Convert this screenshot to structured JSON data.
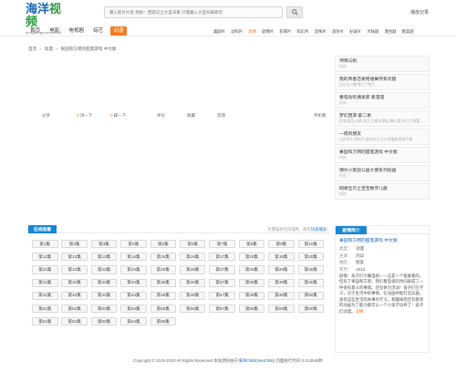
{
  "logo": {
    "main_a": "海洋",
    "main_b": "视频",
    "sub": "dongfangmovie.com"
  },
  "search": {
    "placeholder": "输入影片片名 例如：西游记之大圣归来 只需输入大圣归来即可"
  },
  "history": "播放记录",
  "nav": {
    "main": [
      "首页",
      "电影",
      "电视剧",
      "综艺",
      "动漫"
    ],
    "active": 4,
    "sub": [
      "喜剧片",
      "动作片",
      "爱情",
      "剧情片",
      "犯罪片",
      "科幻片",
      "恐怖片",
      "战争片",
      "纪录片",
      "大陆剧",
      "港台剧",
      "欧美剧"
    ],
    "sub_active": 2
  },
  "breadcrumb": [
    "首页",
    "动漫",
    "果园和方明的甜蜜游戏 中文版"
  ],
  "toolbar": {
    "share": "分享",
    "up_count": "0",
    "up": "顶一下",
    "down_count": "0",
    "down": "踩一下",
    "comment": "评论",
    "favorite": "收藏",
    "report": "反馈",
    "phone": "手机看"
  },
  "sidebar": [
    {
      "title": "师傅与帆",
      "sub": "内详"
    },
    {
      "title": "我的青春恋爱物语果然有问题",
      "sub": "比企谷八幡,雪之下雪乃"
    },
    {
      "title": "番电动玩偶发家 看漫漫",
      "sub": "内详"
    },
    {
      "title": "梦幻西游 第二季",
      "sub": "俞涛,梁吾,白桦,张卫,王硕金,黄松,魏小爱,刘力刀,陈蕾"
    },
    {
      "title": "一周的朋友",
      "sub": "山谷祥生,雨宫天,细谷佳正,大久保瑠美,野波千鹤"
    },
    {
      "title": "果园和方明的甜蜜游戏 中文版",
      "sub": "内详"
    },
    {
      "title": "瑞尔小旅鼠公益大使系列动画",
      "sub": "内详"
    },
    {
      "title": "网课全贝之宝宝数学儿歌",
      "sub": "内详"
    }
  ],
  "playlist": {
    "tab": "在线观看",
    "note_a": "无需安装任何插件，即可",
    "note_b": "快速播放",
    "episodes": [
      "第1集",
      "第2集",
      "第3集",
      "第4集",
      "第5集",
      "第6集",
      "第7集",
      "第8集",
      "第9集",
      "第10集",
      "第11集",
      "第12集",
      "第13集",
      "第14集",
      "第15集",
      "第16集",
      "第17集",
      "第18集",
      "第19集",
      "第20集",
      "第21集",
      "第22集",
      "第23集",
      "第24集",
      "第25集",
      "第26集",
      "第27集",
      "第28集",
      "第29集",
      "第30集",
      "第31集",
      "第32集",
      "第33集",
      "第34集",
      "第35集",
      "第36集",
      "第37集",
      "第38集",
      "第39集",
      "第40集",
      "第41集",
      "第42集",
      "第43集",
      "第44集",
      "第45集",
      "第46集",
      "第47集",
      "第48集",
      "第49集",
      "第50集",
      "第51集",
      "第52集",
      "第53集",
      "第54集",
      "第55集",
      "第56集",
      "第57集",
      "第58集",
      "第59集",
      "第60集",
      "第61集",
      "第62集",
      "第63集",
      "第64集",
      "第65集"
    ]
  },
  "info": {
    "tab": "剧情简介",
    "title": "果园和方明的甜蜜游戏 中文版",
    "rows": [
      {
        "k": "类型：",
        "v": "动漫"
      },
      {
        "k": "主演：",
        "v": "内详"
      },
      {
        "k": "地区：",
        "v": "欧美"
      },
      {
        "k": "年代：",
        "v": "2013"
      }
    ],
    "desc": "剧情：孩子们冷餐电视——这是一个极难看的。但有了果园和方明，我们看电视的时间就成了一件很有意义的事情。还有休力活动！孩子们在学习，对于生活中的事情，在动画中能打造兵器，发觉这些生活的本事的学习。和趣味而且有教育的动画为了能力都可以一个小孩子培养了！孩子们动漫。",
    "more": "详细"
  },
  "footer": {
    "copy": "Copyright © 2015-2020 All Rights Reserved 本站源码由于",
    "cms": "海洋CMS(SeaCMS)",
    "time": "页面执行时间 0.013848秒"
  },
  "colors": {
    "accent": "#f57b20",
    "blue": "#1887d6",
    "green": "#2a9a3c"
  }
}
